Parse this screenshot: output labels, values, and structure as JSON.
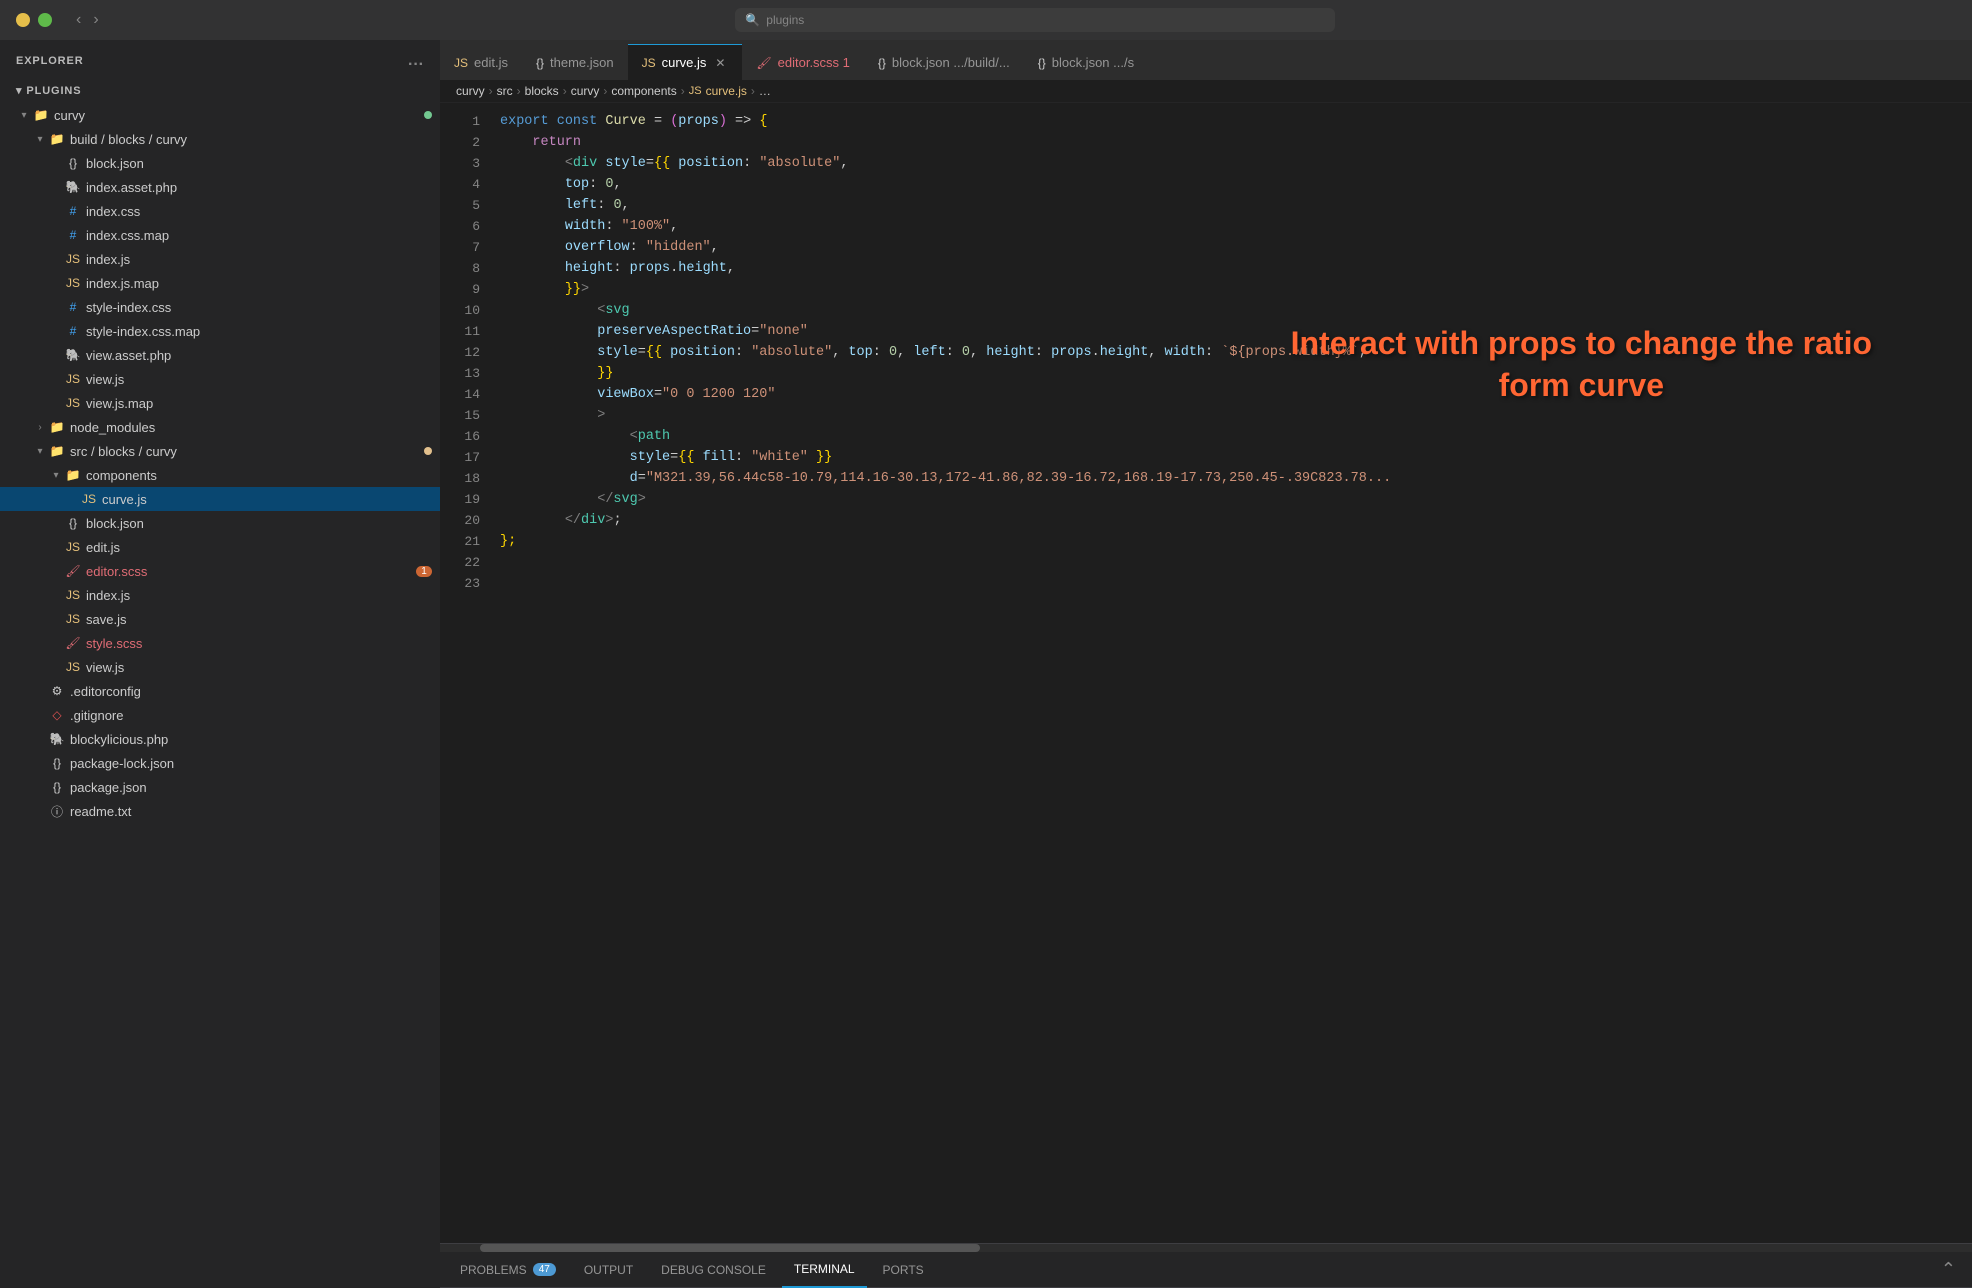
{
  "titleBar": {
    "searchPlaceholder": "plugins"
  },
  "sidebar": {
    "header": "EXPLORER",
    "moreIcon": "...",
    "sections": [
      {
        "label": "PLUGINS",
        "expanded": true,
        "items": [
          {
            "id": "curvy",
            "label": "curvy",
            "type": "folder",
            "depth": 1,
            "expanded": true,
            "dot": "green"
          },
          {
            "id": "build-blocks-curvy",
            "label": "build / blocks / curvy",
            "type": "folder",
            "depth": 2,
            "expanded": true
          },
          {
            "id": "block-json-1",
            "label": "block.json",
            "type": "json",
            "depth": 3
          },
          {
            "id": "index-asset-php",
            "label": "index.asset.php",
            "type": "php",
            "depth": 3
          },
          {
            "id": "index-css",
            "label": "index.css",
            "type": "css",
            "depth": 3
          },
          {
            "id": "index-css-map",
            "label": "index.css.map",
            "type": "cssmap",
            "depth": 3
          },
          {
            "id": "index-js-1",
            "label": "index.js",
            "type": "js",
            "depth": 3
          },
          {
            "id": "index-js-map",
            "label": "index.js.map",
            "type": "jsmap",
            "depth": 3
          },
          {
            "id": "style-index-css",
            "label": "style-index.css",
            "type": "css",
            "depth": 3
          },
          {
            "id": "style-index-css-map",
            "label": "style-index.css.map",
            "type": "cssmap",
            "depth": 3
          },
          {
            "id": "view-asset-php",
            "label": "view.asset.php",
            "type": "php",
            "depth": 3
          },
          {
            "id": "view-js",
            "label": "view.js",
            "type": "js",
            "depth": 3
          },
          {
            "id": "view-js-map",
            "label": "view.js.map",
            "type": "jsmap",
            "depth": 3
          },
          {
            "id": "node-modules",
            "label": "node_modules",
            "type": "folder",
            "depth": 2,
            "collapsed": true
          },
          {
            "id": "src-blocks-curvy",
            "label": "src / blocks / curvy",
            "type": "folder",
            "depth": 2,
            "expanded": true,
            "dot": "yellow"
          },
          {
            "id": "components",
            "label": "components",
            "type": "folder",
            "depth": 3,
            "expanded": true
          },
          {
            "id": "curve-js",
            "label": "curve.js",
            "type": "js",
            "depth": 4,
            "active": true
          },
          {
            "id": "block-json-2",
            "label": "block.json",
            "type": "json",
            "depth": 3
          },
          {
            "id": "edit-js",
            "label": "edit.js",
            "type": "js",
            "depth": 3
          },
          {
            "id": "editor-scss",
            "label": "editor.scss",
            "type": "scss",
            "depth": 3,
            "badge": 1
          },
          {
            "id": "index-js-2",
            "label": "index.js",
            "type": "js",
            "depth": 3
          },
          {
            "id": "save-js",
            "label": "save.js",
            "type": "js",
            "depth": 3
          },
          {
            "id": "style-scss",
            "label": "style.scss",
            "type": "scss",
            "depth": 3
          },
          {
            "id": "view-js-2",
            "label": "view.js",
            "type": "js",
            "depth": 3
          },
          {
            "id": "editorconfig",
            "label": ".editorconfig",
            "type": "gear",
            "depth": 2
          },
          {
            "id": "gitignore",
            "label": ".gitignore",
            "type": "git",
            "depth": 2
          },
          {
            "id": "blockylicious-php",
            "label": "blockylicious.php",
            "type": "php",
            "depth": 2
          },
          {
            "id": "package-lock-json",
            "label": "package-lock.json",
            "type": "json",
            "depth": 2
          },
          {
            "id": "package-json",
            "label": "package.json",
            "type": "json",
            "depth": 2
          },
          {
            "id": "readme-txt",
            "label": "readme.txt",
            "type": "txt",
            "depth": 2
          }
        ]
      }
    ]
  },
  "tabs": [
    {
      "id": "edit-js",
      "label": "edit.js",
      "type": "js",
      "active": false
    },
    {
      "id": "theme-json",
      "label": "theme.json",
      "type": "json",
      "active": false
    },
    {
      "id": "curve-js",
      "label": "curve.js",
      "type": "js",
      "active": true
    },
    {
      "id": "editor-scss",
      "label": "editor.scss 1",
      "type": "scss",
      "active": false,
      "dirty": true
    },
    {
      "id": "block-json-build",
      "label": "block.json .../build/...",
      "type": "json",
      "active": false
    },
    {
      "id": "block-json-src",
      "label": "block.json .../s",
      "type": "json",
      "active": false
    }
  ],
  "breadcrumb": {
    "parts": [
      "curvy",
      ">",
      "src",
      ">",
      "blocks",
      ">",
      "curvy",
      ">",
      "components",
      ">",
      "curve.js",
      ">",
      "…"
    ]
  },
  "codeLines": [
    {
      "num": 1,
      "tokens": [
        {
          "t": "kw",
          "v": "export"
        },
        {
          "t": "ws",
          "v": " "
        },
        {
          "t": "kw",
          "v": "const"
        },
        {
          "t": "ws",
          "v": " "
        },
        {
          "t": "fn",
          "v": "Curve"
        },
        {
          "t": "ws",
          "v": " "
        },
        {
          "t": "punct",
          "v": "="
        },
        {
          "t": "ws",
          "v": " "
        },
        {
          "t": "paren",
          "v": "("
        },
        {
          "t": "var",
          "v": "props"
        },
        {
          "t": "paren",
          "v": ")"
        },
        {
          "t": "ws",
          "v": " "
        },
        {
          "t": "punct",
          "v": "=>"
        },
        {
          "t": "ws",
          "v": " "
        },
        {
          "t": "bracket",
          "v": "{"
        }
      ]
    },
    {
      "num": 2,
      "tokens": [
        {
          "t": "ws",
          "v": "    "
        },
        {
          "t": "kw2",
          "v": "return"
        }
      ]
    },
    {
      "num": 3,
      "tokens": [
        {
          "t": "ws",
          "v": "        "
        },
        {
          "t": "jsx-tag",
          "v": "<div"
        },
        {
          "t": "ws",
          "v": " "
        },
        {
          "t": "attr",
          "v": "style"
        },
        {
          "t": "punct",
          "v": "="
        },
        {
          "t": "bracket",
          "v": "{{"
        },
        {
          "t": "ws",
          "v": " "
        },
        {
          "t": "attr",
          "v": "position"
        },
        {
          "t": "punct",
          "v": ":"
        },
        {
          "t": "ws",
          "v": " "
        },
        {
          "t": "str",
          "v": "\"absolute\""
        },
        {
          "t": "punct",
          "v": ","
        }
      ]
    },
    {
      "num": 4,
      "tokens": [
        {
          "t": "ws",
          "v": "        "
        },
        {
          "t": "attr",
          "v": "top"
        },
        {
          "t": "punct",
          "v": ":"
        },
        {
          "t": "ws",
          "v": " "
        },
        {
          "t": "num",
          "v": "0"
        },
        {
          "t": "punct",
          "v": ","
        }
      ]
    },
    {
      "num": 5,
      "tokens": [
        {
          "t": "ws",
          "v": "        "
        },
        {
          "t": "attr",
          "v": "left"
        },
        {
          "t": "punct",
          "v": ":"
        },
        {
          "t": "ws",
          "v": " "
        },
        {
          "t": "num",
          "v": "0"
        },
        {
          "t": "punct",
          "v": ","
        }
      ]
    },
    {
      "num": 6,
      "tokens": [
        {
          "t": "ws",
          "v": "        "
        },
        {
          "t": "attr",
          "v": "width"
        },
        {
          "t": "punct",
          "v": ":"
        },
        {
          "t": "ws",
          "v": " "
        },
        {
          "t": "str",
          "v": "\"100%\""
        },
        {
          "t": "punct",
          "v": ","
        }
      ]
    },
    {
      "num": 7,
      "tokens": [
        {
          "t": "ws",
          "v": "        "
        },
        {
          "t": "attr",
          "v": "overflow"
        },
        {
          "t": "punct",
          "v": ":"
        },
        {
          "t": "ws",
          "v": " "
        },
        {
          "t": "str",
          "v": "\"hidden\""
        },
        {
          "t": "punct",
          "v": ","
        }
      ]
    },
    {
      "num": 8,
      "tokens": [
        {
          "t": "ws",
          "v": "        "
        },
        {
          "t": "attr",
          "v": "height"
        },
        {
          "t": "punct",
          "v": ":"
        },
        {
          "t": "ws",
          "v": " "
        },
        {
          "t": "var",
          "v": "props"
        },
        {
          "t": "punct",
          "v": "."
        },
        {
          "t": "var",
          "v": "height"
        },
        {
          "t": "punct",
          "v": ","
        }
      ]
    },
    {
      "num": 9,
      "tokens": [
        {
          "t": "ws",
          "v": "        "
        },
        {
          "t": "bracket",
          "v": "}}"
        },
        {
          "t": "jsx-tag",
          "v": ">"
        }
      ]
    },
    {
      "num": 10,
      "tokens": [
        {
          "t": "ws",
          "v": "            "
        },
        {
          "t": "jsx-tag",
          "v": "<svg"
        }
      ]
    },
    {
      "num": 11,
      "tokens": [
        {
          "t": "ws",
          "v": "            "
        },
        {
          "t": "attr",
          "v": "preserveAspectRatio"
        },
        {
          "t": "punct",
          "v": "="
        },
        {
          "t": "str",
          "v": "\"none\""
        }
      ]
    },
    {
      "num": 12,
      "tokens": [
        {
          "t": "ws",
          "v": "            "
        },
        {
          "t": "attr",
          "v": "style"
        },
        {
          "t": "punct",
          "v": "="
        },
        {
          "t": "bracket",
          "v": "{{"
        },
        {
          "t": "ws",
          "v": " "
        },
        {
          "t": "attr",
          "v": "position"
        },
        {
          "t": "punct",
          "v": ":"
        },
        {
          "t": "ws",
          "v": " "
        },
        {
          "t": "str",
          "v": "\"absolute\""
        },
        {
          "t": "punct",
          "v": ","
        },
        {
          "t": "ws",
          "v": " "
        },
        {
          "t": "attr",
          "v": "top"
        },
        {
          "t": "punct",
          "v": ":"
        },
        {
          "t": "ws",
          "v": " "
        },
        {
          "t": "num",
          "v": "0"
        },
        {
          "t": "punct",
          "v": ","
        },
        {
          "t": "ws",
          "v": " "
        },
        {
          "t": "attr",
          "v": "left"
        },
        {
          "t": "punct",
          "v": ":"
        },
        {
          "t": "ws",
          "v": " "
        },
        {
          "t": "num",
          "v": "0"
        },
        {
          "t": "punct",
          "v": ","
        },
        {
          "t": "ws",
          "v": " "
        },
        {
          "t": "attr",
          "v": "height"
        },
        {
          "t": "punct",
          "v": ":"
        },
        {
          "t": "ws",
          "v": " "
        },
        {
          "t": "var",
          "v": "props"
        },
        {
          "t": "punct",
          "v": "."
        },
        {
          "t": "var",
          "v": "height"
        },
        {
          "t": "punct",
          "v": ","
        },
        {
          "t": "ws",
          "v": " "
        },
        {
          "t": "attr",
          "v": "width"
        },
        {
          "t": "punct",
          "v": ":"
        },
        {
          "t": "ws",
          "v": " "
        },
        {
          "t": "str",
          "v": "` ${props.width}%`"
        },
        {
          "t": "punct",
          "v": ","
        }
      ]
    },
    {
      "num": 13,
      "tokens": [
        {
          "t": "ws",
          "v": "            "
        },
        {
          "t": "bracket",
          "v": "}}"
        }
      ]
    },
    {
      "num": 14,
      "tokens": [
        {
          "t": "ws",
          "v": "            "
        },
        {
          "t": "attr",
          "v": "viewBox"
        },
        {
          "t": "punct",
          "v": "="
        },
        {
          "t": "str",
          "v": "\"0 0 1200 120\""
        }
      ]
    },
    {
      "num": 15,
      "tokens": [
        {
          "t": "ws",
          "v": "            "
        },
        {
          "t": "jsx-tag",
          "v": ">"
        }
      ]
    },
    {
      "num": 16,
      "tokens": [
        {
          "t": "ws",
          "v": "                "
        },
        {
          "t": "jsx-tag",
          "v": "<path"
        }
      ]
    },
    {
      "num": 17,
      "tokens": [
        {
          "t": "ws",
          "v": "                "
        },
        {
          "t": "attr",
          "v": "style"
        },
        {
          "t": "punct",
          "v": "="
        },
        {
          "t": "bracket",
          "v": "{{"
        },
        {
          "t": "ws",
          "v": " "
        },
        {
          "t": "attr",
          "v": "fill"
        },
        {
          "t": "punct",
          "v": ":"
        },
        {
          "t": "ws",
          "v": " "
        },
        {
          "t": "str",
          "v": "\"white\""
        },
        {
          "t": "ws",
          "v": " "
        },
        {
          "t": "bracket",
          "v": "}}"
        }
      ]
    },
    {
      "num": 18,
      "tokens": [
        {
          "t": "ws",
          "v": "                "
        },
        {
          "t": "attr",
          "v": "d"
        },
        {
          "t": "punct",
          "v": "="
        },
        {
          "t": "str",
          "v": "\"M321.39,56.44c58-10.79,114.16-30.13,172-41.86,82.39-16.72,168.19-17.73,250.45-.39C823.78..."
        }
      ]
    },
    {
      "num": 19,
      "tokens": [
        {
          "t": "ws",
          "v": "            "
        },
        {
          "t": "jsx-tag",
          "v": "</svg>"
        }
      ]
    },
    {
      "num": 20,
      "tokens": [
        {
          "t": "ws",
          "v": "        "
        },
        {
          "t": "jsx-tag",
          "v": "</div>"
        },
        {
          "t": "punct",
          "v": ";"
        }
      ]
    },
    {
      "num": 21,
      "tokens": [
        {
          "t": "bracket",
          "v": "};"
        }
      ]
    },
    {
      "num": 22,
      "tokens": []
    },
    {
      "num": 23,
      "tokens": []
    }
  ],
  "overlay": {
    "line1": "Interact with props to change the ratio",
    "line2": "form curve"
  },
  "bottomPanel": {
    "tabs": [
      {
        "id": "problems",
        "label": "PROBLEMS",
        "badge": "47"
      },
      {
        "id": "output",
        "label": "OUTPUT"
      },
      {
        "id": "debug-console",
        "label": "DEBUG CONSOLE"
      },
      {
        "id": "terminal",
        "label": "TERMINAL",
        "active": true
      },
      {
        "id": "ports",
        "label": "PORTS"
      }
    ]
  }
}
